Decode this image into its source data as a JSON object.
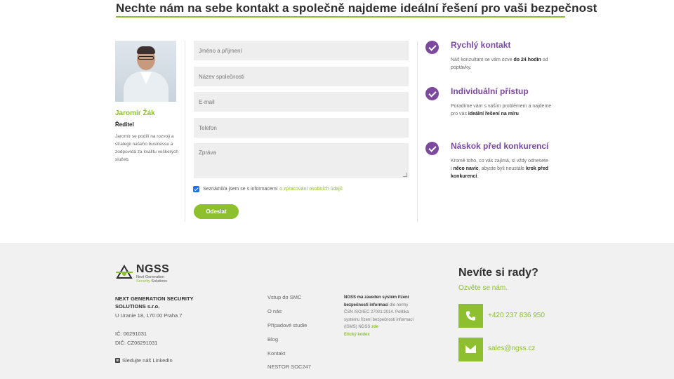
{
  "section": {
    "heading": "Nechte nám na sebe kontakt a společně najdeme ideální řešení pro vaši bezpečnost"
  },
  "person": {
    "name": "Jaromír Žák",
    "role": "Ředitel",
    "description": "Jaromír se podílí na rozvoji a strategii našeho businessu a zodpovídá za kvalitu veškerých služeb."
  },
  "form": {
    "name_placeholder": "Jméno a příjmení",
    "company_placeholder": "Název společnosti",
    "email_placeholder": "E-mail",
    "phone_placeholder": "Telefon",
    "message_placeholder": "Zpráva",
    "consent_checked": true,
    "consent_text": "Seznámil/a jsem se s informacemi",
    "consent_link": "o zpracování osobních údajů",
    "submit_label": "Odeslat"
  },
  "benefits": [
    {
      "title": "Rychlý kontakt",
      "text_before": "Náš konzultant se vám ozve ",
      "text_bold": "do 24 hodin",
      "text_after": " od poptávky."
    },
    {
      "title": "Individuální přístup",
      "text_before": "Poradíme vám s vaším problémem a najdeme pro vás ",
      "text_bold": "ideální řešení na míru",
      "text_after": ""
    },
    {
      "title": "Náskok před konkurencí",
      "text_before": "Kromě toho, co vás zajímá, si vždy odnesete i ",
      "text_bold": "něco navíc",
      "text_middle": ", abyste byli neustále ",
      "text_bold2": "krok před konkurencí",
      "text_after": "."
    }
  ],
  "footer": {
    "logo_text": "NGSS",
    "logo_sub_1": "Next Generation",
    "logo_sub_2a": "Security",
    "logo_sub_2b": " Solutions",
    "company_name": "NEXT GENERATION SECURITY SOLUTIONS s.r.o.",
    "address": "U Uranie 18, 170 00 Praha 7",
    "ic": "IČ: 06291031",
    "dic": "DIČ: CZ06291031",
    "linkedin": "Sledujte náš LinkedIn",
    "nav": [
      "Vstup do SMC",
      "O nás",
      "Případové studie",
      "Blog",
      "Kontakt",
      "NESTOR SOC247"
    ],
    "iso_bold": "NGSS má zaveden systém řízení bezpečnosti informací",
    "iso_text": "dle normy ČSN ISO/IEC 27001:2014. Politika systému řízení bezpečnosti informací (ISMS) NGSS ",
    "iso_link": "zde",
    "iso_code": "Etický kodex",
    "help_title": "Nevíte si rady?",
    "help_sub": "Ozvěte se nám.",
    "phone": "+420 237 836 950",
    "email": "sales@ngss.cz"
  },
  "colors": {
    "accent_green": "#8dbf2e",
    "accent_purple": "#7b4a9e"
  }
}
